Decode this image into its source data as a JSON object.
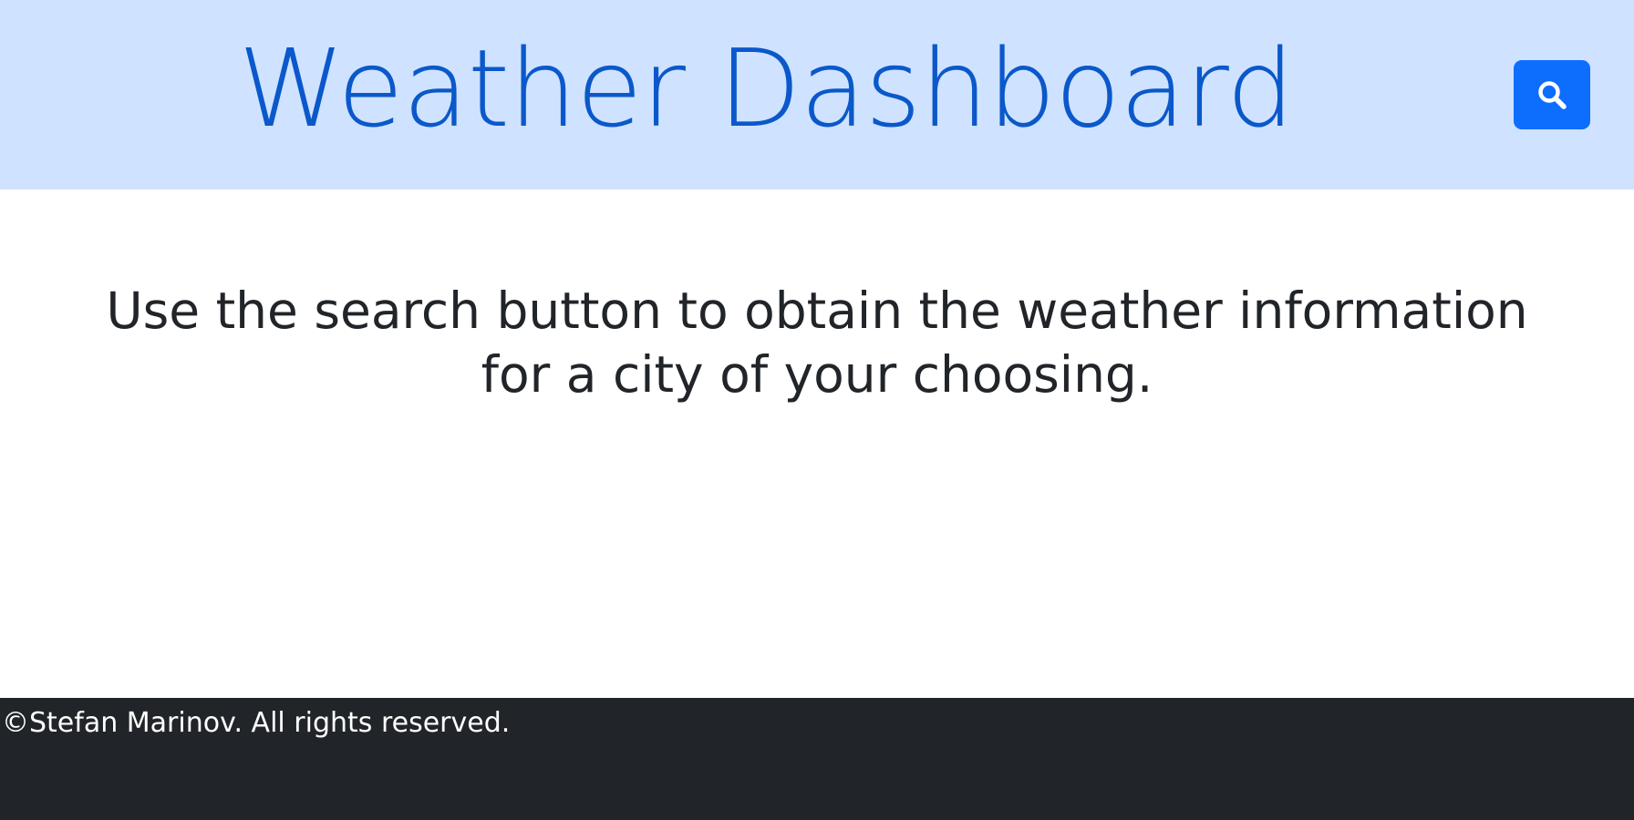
{
  "header": {
    "title": "Weather Dashboard",
    "search_button": {
      "icon": "search-icon"
    }
  },
  "main": {
    "instructions": "Use the search button to obtain the weather information for a city of your choosing."
  },
  "footer": {
    "copyright": "©Stefan Marinov. All rights reserved."
  },
  "colors": {
    "header_background": "#cfe2ff",
    "title_color": "#0a58ca",
    "button_background": "#0d6efd",
    "body_text": "#212529",
    "footer_background": "#212529",
    "footer_text": "#ffffff"
  }
}
